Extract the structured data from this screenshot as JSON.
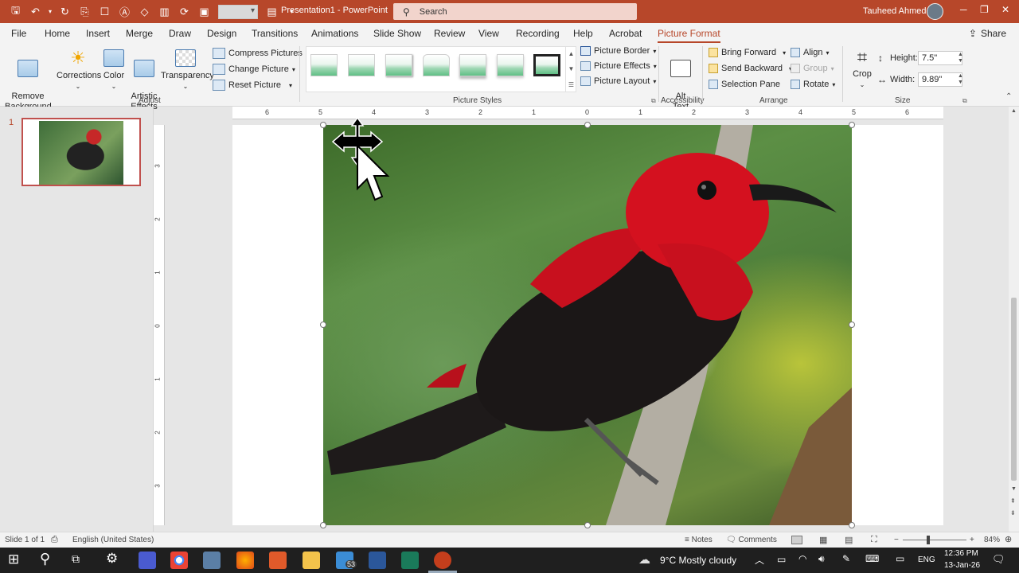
{
  "app": {
    "document_title": "Presentation1  -  PowerPoint",
    "search_placeholder": "Search",
    "user_name": "Tauheed Ahmed"
  },
  "colors": {
    "accent": "#b7472a",
    "ribbon": "#f3f3f3"
  },
  "tabs": [
    "File",
    "Home",
    "Insert",
    "Merge",
    "Draw",
    "Design",
    "Transitions",
    "Animations",
    "Slide Show",
    "Review",
    "View",
    "Recording",
    "Help",
    "Acrobat",
    "Picture Format"
  ],
  "share_label": "Share",
  "ribbon": {
    "adjust": {
      "remove_background": "Remove\nBackground",
      "corrections": "Corrections",
      "color": "Color",
      "artistic_effects": "Artistic\nEffects",
      "transparency": "Transparency",
      "compress_pictures": "Compress Pictures",
      "change_picture": "Change Picture",
      "reset_picture": "Reset Picture",
      "group_label": "Adjust"
    },
    "picture_styles": {
      "picture_border": "Picture Border",
      "picture_effects": "Picture Effects",
      "picture_layout": "Picture Layout",
      "group_label": "Picture Styles"
    },
    "accessibility": {
      "alt_text": "Alt\nText",
      "group_label": "Accessibility"
    },
    "arrange": {
      "bring_forward": "Bring Forward",
      "send_backward": "Send Backward",
      "selection_pane": "Selection Pane",
      "align": "Align",
      "group": "Group",
      "rotate": "Rotate",
      "group_label": "Arrange"
    },
    "size": {
      "crop": "Crop",
      "height_label": "Height:",
      "height_value": "7.5\"",
      "width_label": "Width:",
      "width_value": "9.89\"",
      "group_label": "Size"
    }
  },
  "thumbnail": {
    "slide_number": "1"
  },
  "ruler": {
    "h_ticks": [
      "6",
      "5",
      "4",
      "3",
      "2",
      "1",
      "0",
      "1",
      "2",
      "3",
      "4",
      "5",
      "6"
    ],
    "v_ticks": [
      "3",
      "2",
      "1",
      "0",
      "1",
      "2",
      "3"
    ]
  },
  "status": {
    "slide_count": "Slide 1 of 1",
    "language": "English (United States)",
    "notes": "Notes",
    "comments": "Comments",
    "zoom": "84%"
  },
  "taskbar": {
    "badge": "53",
    "weather": "9°C  Mostly cloudy",
    "lang": "ENG",
    "time": "12:36 PM",
    "date": "13-Jan-26"
  }
}
